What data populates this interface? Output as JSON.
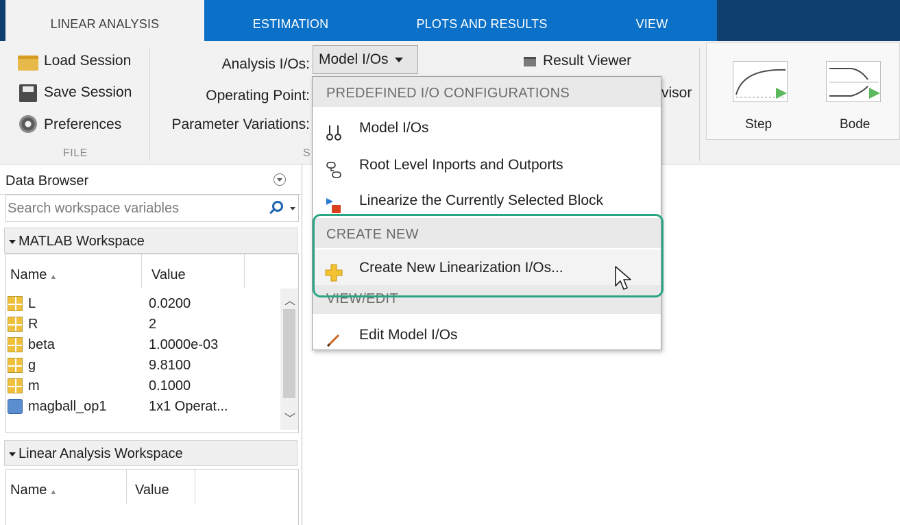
{
  "tabs": [
    {
      "label": "LINEAR ANALYSIS",
      "active": true
    },
    {
      "label": "ESTIMATION",
      "active": false
    },
    {
      "label": "PLOTS AND RESULTS",
      "active": false
    },
    {
      "label": "VIEW",
      "active": false
    }
  ],
  "file_section": {
    "load_session": "Load Session",
    "save_session": "Save Session",
    "preferences": "Preferences",
    "label": "FILE"
  },
  "setup_section": {
    "analysis_ios_label": "Analysis I/Os:",
    "analysis_ios_value": "Model I/Os",
    "operating_point_label": "Operating Point:",
    "parameter_variations_label": "Parameter Variations:",
    "label_fragment": "S"
  },
  "options_section": {
    "result_viewer": "Result Viewer",
    "advisor_fragment": "visor"
  },
  "plots": {
    "step": "Step",
    "bode": "Bode"
  },
  "data_browser": {
    "title": "Data Browser",
    "search_placeholder": "Search workspace variables",
    "matlab_workspace": "MATLAB Workspace",
    "linear_workspace": "Linear Analysis Workspace",
    "col_name": "Name",
    "col_value": "Value",
    "variables": [
      {
        "name": "L",
        "value": "0.0200",
        "icon": "variable-icon"
      },
      {
        "name": "R",
        "value": "2",
        "icon": "variable-icon"
      },
      {
        "name": "beta",
        "value": "1.0000e-03",
        "icon": "variable-icon"
      },
      {
        "name": "g",
        "value": "9.8100",
        "icon": "variable-icon"
      },
      {
        "name": "m",
        "value": "0.1000",
        "icon": "variable-icon"
      },
      {
        "name": "magball_op1",
        "value": "1x1 Operat...",
        "icon": "operating-point-icon"
      }
    ]
  },
  "menu": {
    "header_predefined": "PREDEFINED I/O CONFIGURATIONS",
    "model_ios": "Model I/Os",
    "root_level": "Root Level Inports and Outports",
    "linearize_selected": "Linearize the Currently Selected Block",
    "header_create": "CREATE NEW",
    "create_new": "Create New Linearization I/Os...",
    "header_view_edit": "VIEW/EDIT",
    "edit_model_ios": "Edit Model I/Os"
  },
  "colors": {
    "tab_blue": "#0b71c8",
    "tab_dark": "#0f3f6f",
    "highlight": "#2aa583"
  }
}
